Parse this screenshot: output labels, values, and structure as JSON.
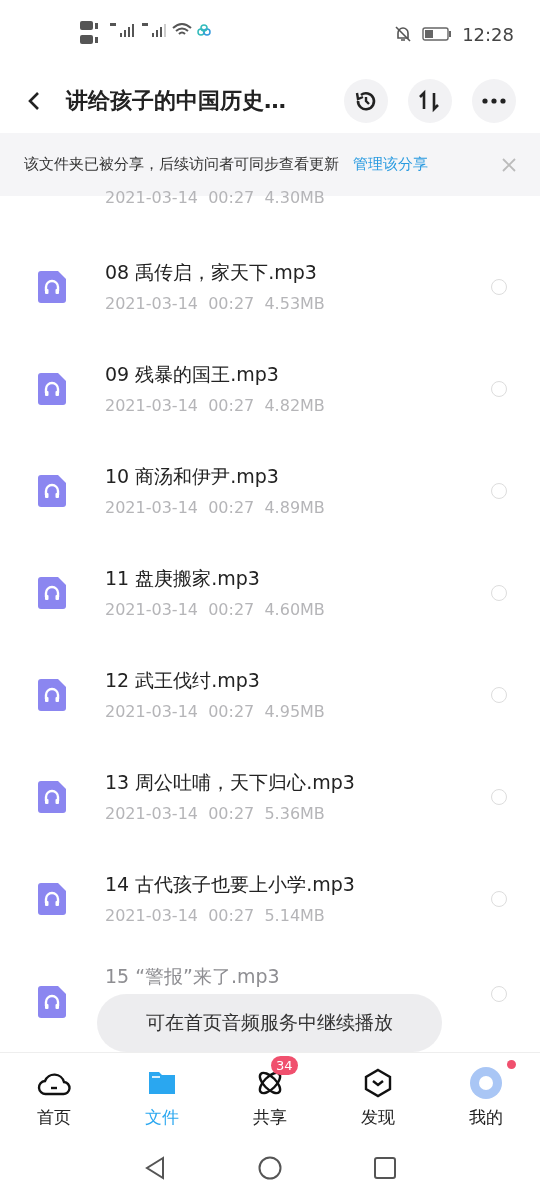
{
  "status_bar": {
    "time": "12:28"
  },
  "header": {
    "title": "讲给孩子的中国历史…"
  },
  "share_notice": {
    "text": "该文件夹已被分享，后续访问者可同步查看更新",
    "link": "管理该分享"
  },
  "files": [
    {
      "kind": "partial",
      "meta": "2021-03-14  00:27  4.30MB"
    },
    {
      "kind": "file",
      "name": "08 禹传启，家天下.mp3",
      "meta": "2021-03-14  00:27  4.53MB",
      "selected": false
    },
    {
      "kind": "file",
      "name": "09 残暴的国王.mp3",
      "meta": "2021-03-14  00:27  4.82MB",
      "selected": false
    },
    {
      "kind": "file",
      "name": "10 商汤和伊尹.mp3",
      "meta": "2021-03-14  00:27  4.89MB",
      "selected": false
    },
    {
      "kind": "file",
      "name": "11 盘庚搬家.mp3",
      "meta": "2021-03-14  00:27  4.60MB",
      "selected": false
    },
    {
      "kind": "file",
      "name": "12 武王伐纣.mp3",
      "meta": "2021-03-14  00:27  4.95MB",
      "selected": false
    },
    {
      "kind": "file",
      "name": "13 周公吐哺，天下归心.mp3",
      "meta": "2021-03-14  00:27  5.36MB",
      "selected": false
    },
    {
      "kind": "file",
      "name": "14 古代孩子也要上小学.mp3",
      "meta": "2021-03-14  00:27  5.14MB",
      "selected": false
    },
    {
      "kind": "file",
      "name": "15 “警报”来了.mp3",
      "selected": false
    }
  ],
  "toast": {
    "text": "可在首页音频服务中继续播放"
  },
  "tabs": [
    {
      "kind": "home",
      "label": "首页",
      "selected": false
    },
    {
      "kind": "files",
      "label": "文件",
      "selected": true
    },
    {
      "kind": "share",
      "label": "共享",
      "selected": false,
      "badge": "34"
    },
    {
      "kind": "discover",
      "label": "发现",
      "selected": false
    },
    {
      "kind": "me",
      "label": "我的",
      "selected": false,
      "dot": true
    }
  ]
}
